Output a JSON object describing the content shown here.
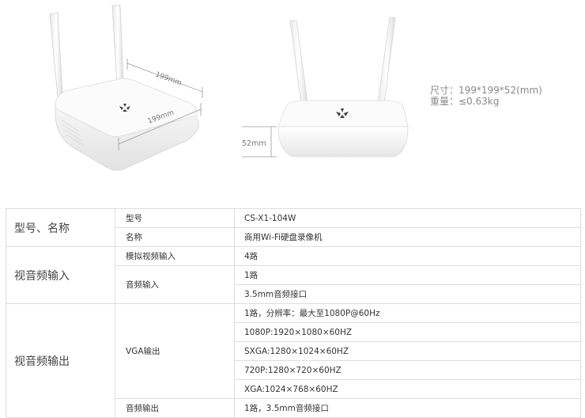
{
  "illustration": {
    "width_dim_label": "199mm",
    "depth_dim_label": "199mm",
    "height_dim_label": "52mm"
  },
  "specs": {
    "size": "尺寸：199*199*52(mm)",
    "weight": "重量：≤0.63kg"
  },
  "table": {
    "model_group": "型号、名称",
    "model_label": "型号",
    "model_value": "CS-X1-104W",
    "name_label": "名称",
    "name_value": "商用Wi-Fi硬盘录像机",
    "av_in_group": "视音频输入",
    "analog_video_in_label": "模拟视频输入",
    "analog_video_in_value": "4路",
    "audio_in_label": "音频输入",
    "audio_in_value_1": "1路",
    "audio_in_value_2": "3.5mm音频接口",
    "av_out_group": "视音频输出",
    "vga_out_label": "VGA输出",
    "vga_values": [
      "1路，分辨率：最大至1080P@60Hz",
      "1080P:1920×1080×60HZ",
      "SXGA:1280×1024×60HZ",
      "720P:1280×720×60HZ",
      "XGA:1024×768×60HZ"
    ],
    "audio_out_label": "音频输出",
    "audio_out_value": "1路，3.5mm音频接口"
  }
}
